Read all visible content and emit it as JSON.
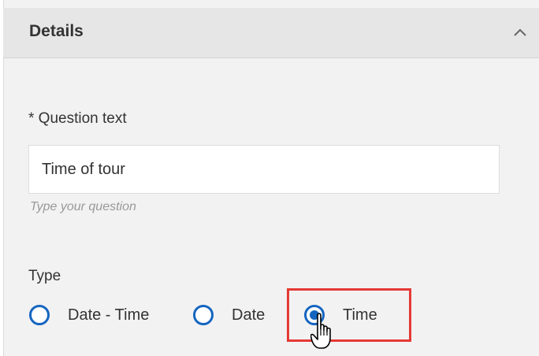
{
  "details": {
    "title": "Details",
    "question_label": "* Question text",
    "question_value": "Time of tour",
    "question_helper": "Type your question",
    "type_label": "Type",
    "type_options": [
      {
        "label": "Date - Time",
        "checked": false
      },
      {
        "label": "Date",
        "checked": false
      },
      {
        "label": "Time",
        "checked": true
      }
    ]
  },
  "colors": {
    "accent": "#1565c0",
    "highlight": "#e53935"
  },
  "icons": {
    "collapse": "chevron-up-icon",
    "cursor": "hand-pointer-icon"
  }
}
